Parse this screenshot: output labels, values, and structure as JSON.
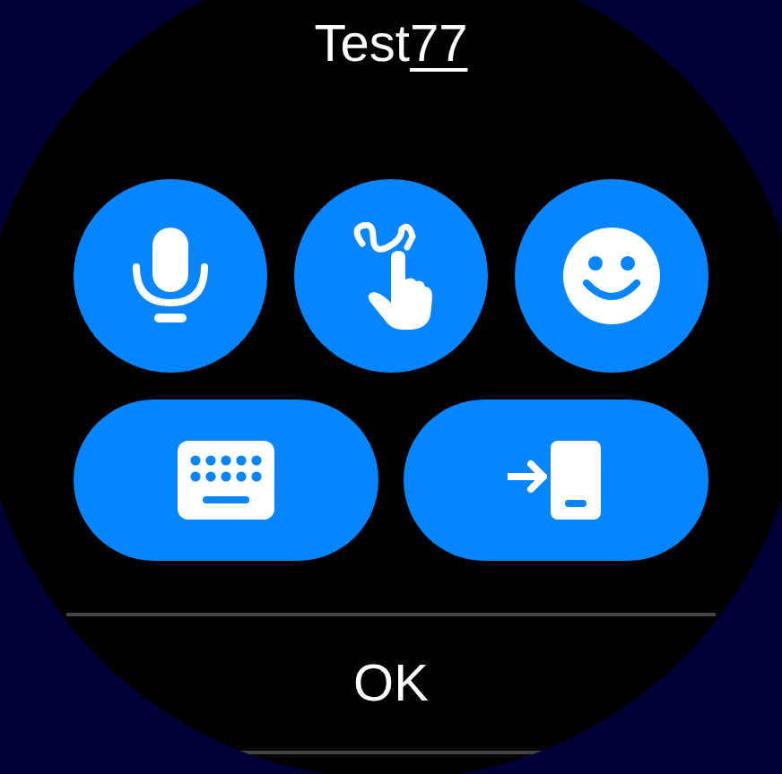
{
  "input": {
    "text": "Test",
    "composing": "77"
  },
  "input_modes": [
    {
      "kind": "voice"
    },
    {
      "kind": "handwriting"
    },
    {
      "kind": "emoji"
    },
    {
      "kind": "keyboard"
    },
    {
      "kind": "phone"
    }
  ],
  "ok_button": "OK"
}
